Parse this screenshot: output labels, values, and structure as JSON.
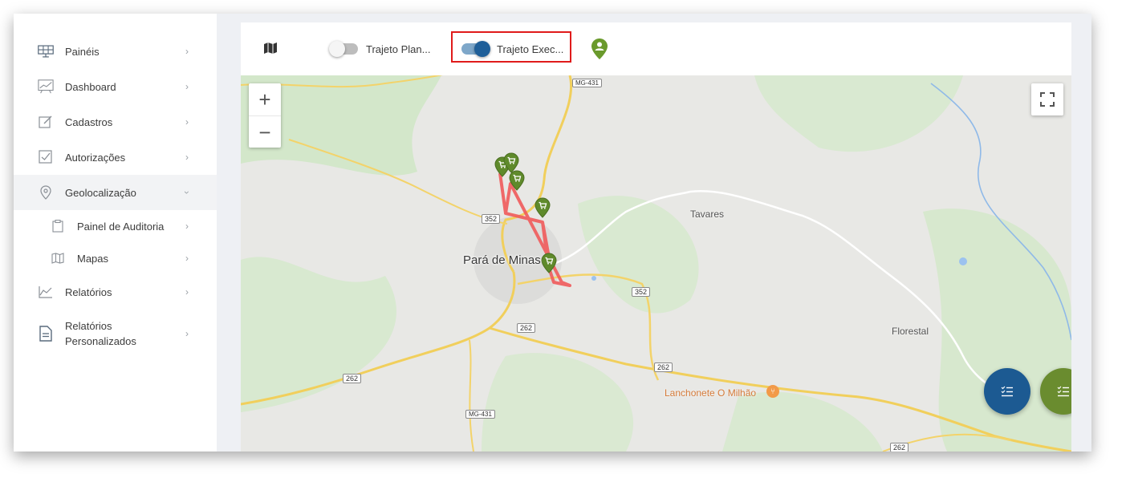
{
  "sidebar": {
    "items": [
      {
        "label": "Painéis",
        "icon": "solar-panel-icon"
      },
      {
        "label": "Dashboard",
        "icon": "chart-board-icon"
      },
      {
        "label": "Cadastros",
        "icon": "edit-icon"
      },
      {
        "label": "Autorizações",
        "icon": "checkbox-icon"
      },
      {
        "label": "Geolocalização",
        "icon": "location-pin-icon"
      },
      {
        "label": "Painel de Auditoria",
        "icon": "clipboard-icon"
      },
      {
        "label": "Mapas",
        "icon": "map-icon"
      },
      {
        "label": "Relatórios",
        "icon": "report-chart-icon"
      },
      {
        "label_line1": "Relatórios",
        "label_line2": "Personalizados",
        "icon": "document-icon"
      }
    ]
  },
  "toolbar": {
    "toggle_planned": {
      "label": "Trajeto Plan...",
      "on": false
    },
    "toggle_executed": {
      "label": "Trajeto Exec...",
      "on": true
    }
  },
  "map": {
    "place_labels": {
      "city": "Pará de Minas",
      "tavares": "Tavares",
      "florestal": "Florestal",
      "poi": "Lanchonete O Milhão"
    },
    "road_shields": {
      "mg431_top": "MG-431",
      "r352_left": "352",
      "r352_right": "352",
      "r262_center": "262",
      "r262_left": "262",
      "r262_mid": "262",
      "mg431_bottom": "MG-431",
      "r262_bottom": "262"
    },
    "zoom_in": "+",
    "zoom_out": "−"
  },
  "colors": {
    "route": "#f05a5a",
    "marker": "#5f8a2b",
    "fab_blue": "#1c5a92",
    "fab_green": "#6a8c2f",
    "highlight": "#e01b1b",
    "toggle_on": "#1f5f99"
  }
}
